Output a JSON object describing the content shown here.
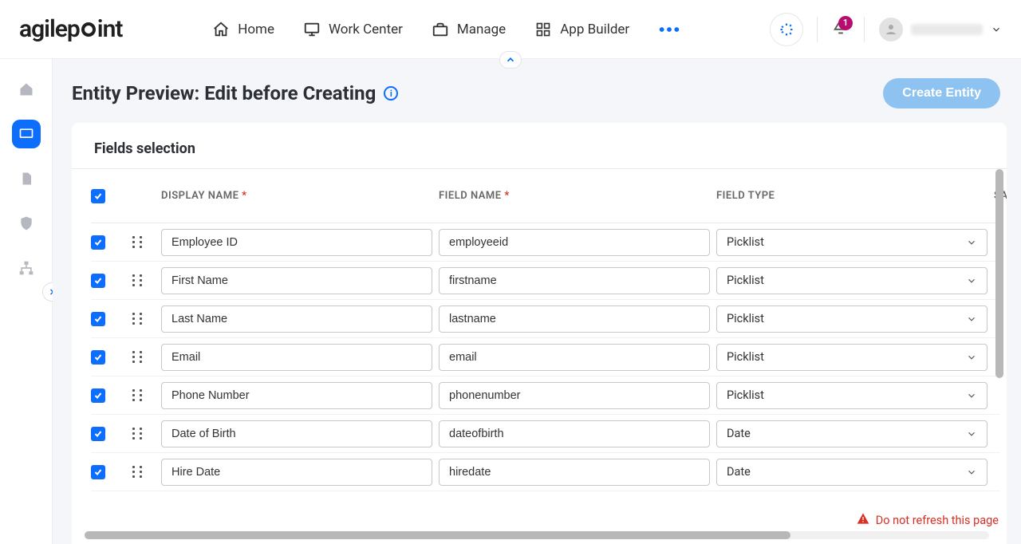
{
  "brand": "agilepoint",
  "nav": {
    "home": "Home",
    "workcenter": "Work Center",
    "manage": "Manage",
    "appbuilder": "App Builder"
  },
  "notif_count": "1",
  "page": {
    "title": "Entity Preview: Edit before Creating",
    "create_btn": "Create Entity"
  },
  "panel": {
    "title": "Fields selection"
  },
  "cols": {
    "display": "DISPLAY NAME",
    "field": "FIELD NAME",
    "type": "FIELD TYPE",
    "extra": "SAMPLE DATA"
  },
  "rows": [
    {
      "display": "Employee ID",
      "field": "employeeid",
      "type": "Picklist"
    },
    {
      "display": "First Name",
      "field": "firstname",
      "type": "Picklist"
    },
    {
      "display": "Last Name",
      "field": "lastname",
      "type": "Picklist"
    },
    {
      "display": "Email",
      "field": "email",
      "type": "Picklist"
    },
    {
      "display": "Phone Number",
      "field": "phonenumber",
      "type": "Picklist"
    },
    {
      "display": "Date of Birth",
      "field": "dateofbirth",
      "type": "Date"
    },
    {
      "display": "Hire Date",
      "field": "hiredate",
      "type": "Date"
    }
  ],
  "warn": "Do not refresh this page"
}
